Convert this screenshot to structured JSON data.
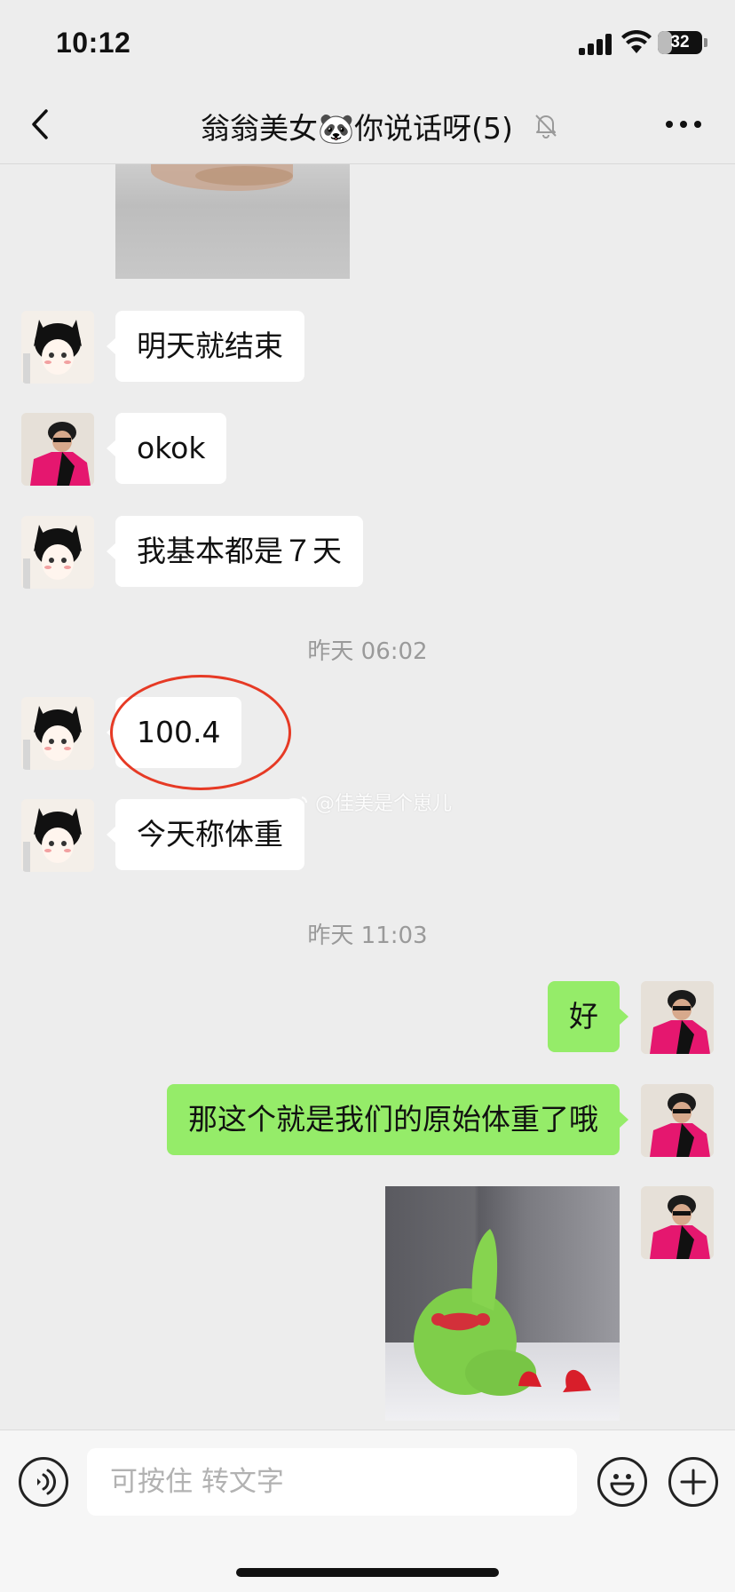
{
  "status_bar": {
    "time": "10:12",
    "battery": "32",
    "battery_level": 0.32
  },
  "nav": {
    "title": "翁翁美女🐼你说话呀(5)",
    "icons": [
      "back-chevron-icon",
      "mute-bell-icon",
      "more-icon"
    ]
  },
  "messages": [
    {
      "side": "left",
      "avatar": "cat-girl-avatar",
      "text": "明天就结束"
    },
    {
      "side": "left",
      "avatar": "pink-jacket-avatar",
      "text": "okok"
    },
    {
      "side": "left",
      "avatar": "cat-girl-avatar",
      "text": "我基本都是７天"
    },
    {
      "type": "timestamp",
      "text": "昨天 06:02"
    },
    {
      "side": "left",
      "avatar": "cat-girl-avatar",
      "text": "100.4",
      "highlighted": true
    },
    {
      "side": "left",
      "avatar": "cat-girl-avatar",
      "text": "今天称体重"
    },
    {
      "type": "timestamp",
      "text": "昨天 11:03"
    },
    {
      "side": "right",
      "avatar": "pink-jacket-avatar",
      "text": "好"
    },
    {
      "side": "right",
      "avatar": "pink-jacket-avatar",
      "text": "那这个就是我们的原始体重了哦"
    },
    {
      "side": "right",
      "avatar": "pink-jacket-avatar",
      "type": "image",
      "image": "green-fluffy-toy-photo"
    }
  ],
  "watermark": "@佳美是个崽儿",
  "input": {
    "placeholder": "可按住 转文字",
    "value": ""
  },
  "colors": {
    "background": "#ededed",
    "sent_bubble": "#95ec69",
    "received_bubble": "#ffffff",
    "highlight_circle": "#e63a25"
  }
}
